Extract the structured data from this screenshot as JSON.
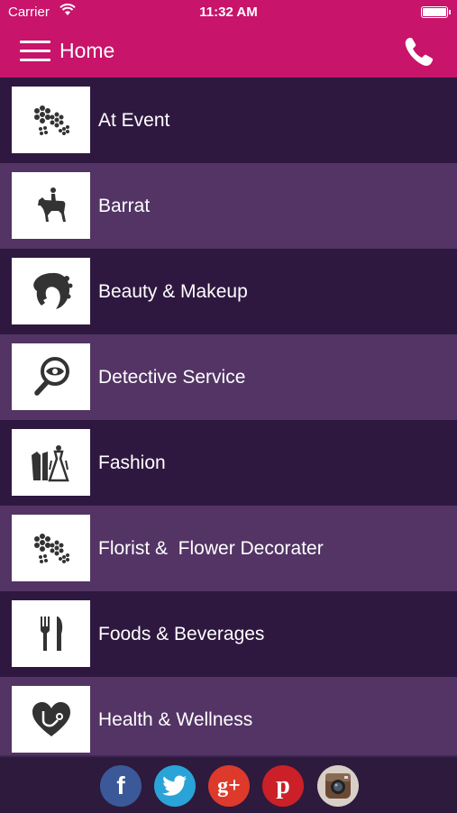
{
  "status_bar": {
    "carrier": "Carrier",
    "time": "11:32 AM"
  },
  "nav": {
    "title": "Home",
    "menu_icon": "hamburger-menu-icon",
    "phone_icon": "phone-icon"
  },
  "categories": [
    {
      "label": "At Event",
      "icon": "flowers-icon"
    },
    {
      "label": "Barrat",
      "icon": "horse-rider-icon"
    },
    {
      "label": "Beauty & Makeup",
      "icon": "woman-face-icon"
    },
    {
      "label": "Detective Service",
      "icon": "magnifier-eye-icon"
    },
    {
      "label": "Fashion",
      "icon": "dress-icon"
    },
    {
      "label": "Florist &  Flower Decorater",
      "icon": "flowers-icon"
    },
    {
      "label": "Foods & Beverages",
      "icon": "fork-knife-icon"
    },
    {
      "label": "Health & Wellness",
      "icon": "heart-stethoscope-icon"
    }
  ],
  "social": [
    {
      "name": "facebook",
      "glyph": "f",
      "color": "#3b5998"
    },
    {
      "name": "twitter",
      "glyph": "",
      "color": "#2aa3d8"
    },
    {
      "name": "google-plus",
      "glyph": "g+",
      "color": "#dd3a2c"
    },
    {
      "name": "pinterest",
      "glyph": "p",
      "color": "#cb2027"
    },
    {
      "name": "instagram",
      "glyph": "",
      "color": "#cccccc"
    }
  ],
  "colors": {
    "accent": "#c8146a",
    "row_dark": "#2f1840",
    "row_light": "#533465"
  }
}
